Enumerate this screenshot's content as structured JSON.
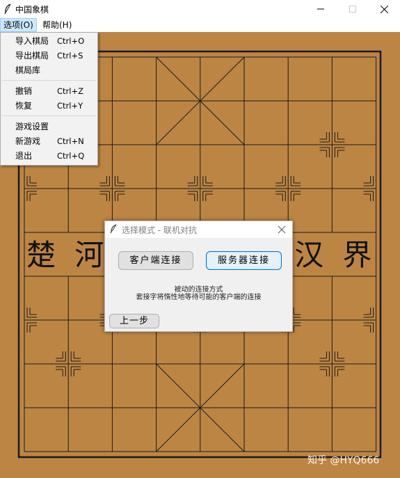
{
  "window": {
    "title": "中国象棋",
    "icon": "feather-icon"
  },
  "menubar": {
    "items": [
      "选项(O)",
      "帮助(H)"
    ]
  },
  "options_menu": {
    "items": [
      {
        "label": "导入棋局",
        "shortcut": "Ctrl+O"
      },
      {
        "label": "导出棋局",
        "shortcut": "Ctrl+S"
      },
      {
        "label": "棋局库",
        "shortcut": ""
      },
      {
        "label": "撤销",
        "shortcut": "Ctrl+Z"
      },
      {
        "label": "恢复",
        "shortcut": "Ctrl+Y"
      },
      {
        "label": "游戏设置",
        "shortcut": ""
      },
      {
        "label": "新游戏",
        "shortcut": "Ctrl+N"
      },
      {
        "label": "退出",
        "shortcut": "Ctrl+Q"
      }
    ]
  },
  "board": {
    "river_left": [
      "楚",
      "河"
    ],
    "river_right": [
      "汉",
      "界"
    ],
    "colors": {
      "wood": "#bd8544",
      "line": "#1a1a1a"
    }
  },
  "dialog": {
    "title": "选择模式 - 联机对抗",
    "client_button": "客户端连接",
    "server_button": "服务器连接",
    "description_line1": "被动的连接方式",
    "description_line2": "套接字将惰性地等待可能的客户端的连接",
    "back_button": "上一步"
  },
  "watermark": "知乎 @HYQ666"
}
